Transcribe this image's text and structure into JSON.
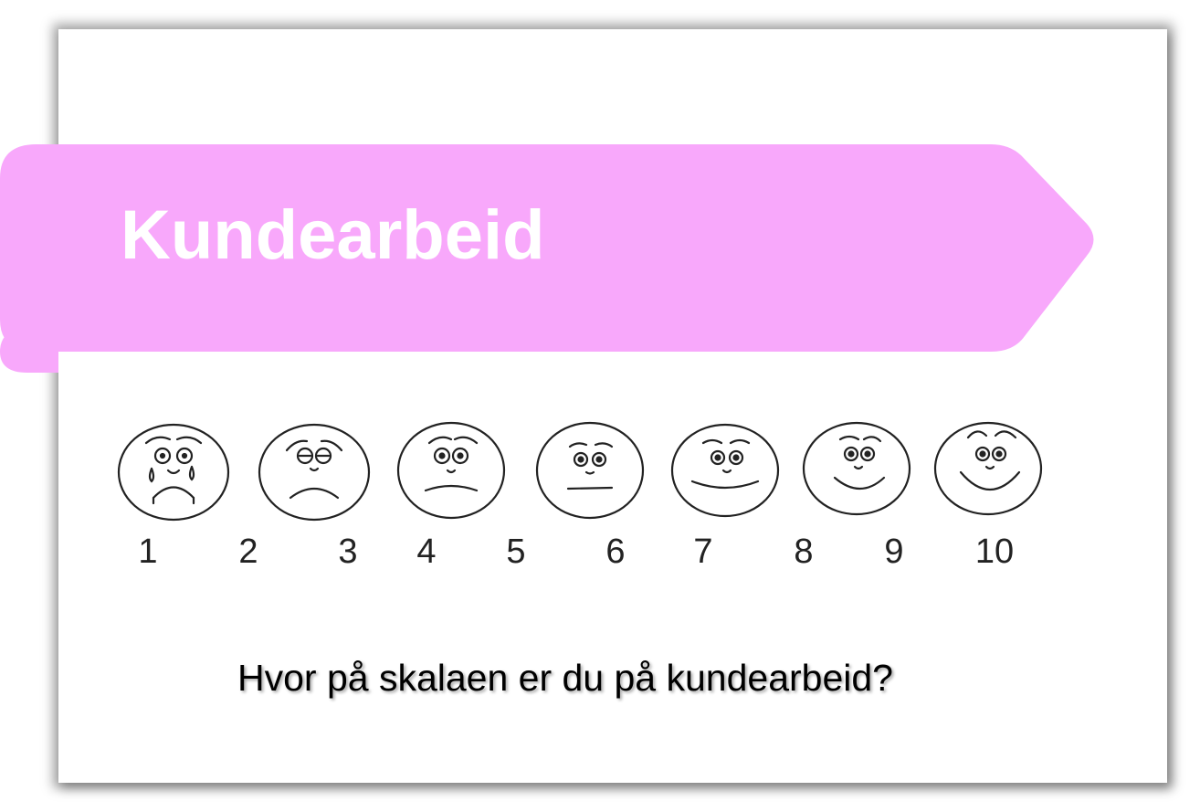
{
  "slide": {
    "title": "Kundearbeid",
    "question": "Hvor på skalaen er du på kundearbeid?"
  },
  "banner": {
    "color": "#f8a8fb"
  },
  "scale": {
    "numbers": [
      "1",
      "2",
      "3",
      "4",
      "5",
      "6",
      "7",
      "8",
      "9",
      "10"
    ],
    "faces": [
      "crying-face-icon",
      "very-sad-face-icon",
      "sad-face-icon",
      "neutral-face-icon",
      "slight-smile-face-icon",
      "smiling-face-icon",
      "big-smile-face-icon"
    ]
  }
}
